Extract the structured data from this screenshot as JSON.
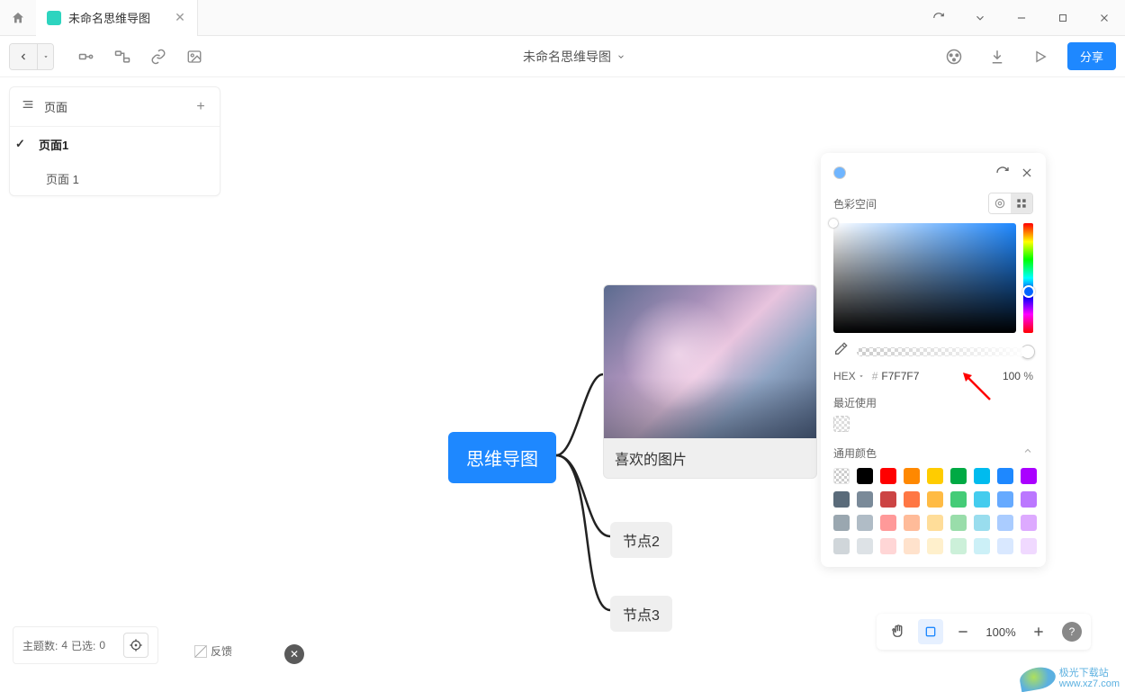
{
  "titlebar": {
    "tab_title": "未命名思维导图"
  },
  "toolbar": {
    "doc_title": "未命名思维导图",
    "share_label": "分享"
  },
  "pages": {
    "header": "页面",
    "items": [
      {
        "label": "页面1",
        "active": true
      },
      {
        "label": "页面 1",
        "active": false
      }
    ]
  },
  "mindmap": {
    "root": "思维导图",
    "image_node_label": "喜欢的图片",
    "node2": "节点2",
    "node3": "节点3"
  },
  "color_picker": {
    "colorspace_label": "色彩空间",
    "hex_label": "HEX",
    "hex_value": "F7F7F7",
    "opacity_value": "100",
    "opacity_unit": "%",
    "recent_label": "最近使用",
    "common_label": "通用颜色",
    "common_colors_row1": [
      "#000000",
      "#ff0000",
      "#ff8800",
      "#ffcc00",
      "#00aa44",
      "#00bbee",
      "#1e88ff",
      "#aa00ff"
    ],
    "common_colors_row2": [
      "#7a8a99",
      "#cc4444",
      "#ff7744",
      "#ffbb44",
      "#44cc77",
      "#44ccee",
      "#66aaff",
      "#bb77ff"
    ],
    "common_colors_row3": [
      "#b0bcc6",
      "#ff9999",
      "#ffbb99",
      "#ffdd99",
      "#99ddaa",
      "#99ddee",
      "#aaccff",
      "#ddaaff"
    ],
    "common_colors_row4": [
      "#dde2e6",
      "#ffd6d6",
      "#ffe2cc",
      "#fff0cc",
      "#ccf0d9",
      "#ccf0f7",
      "#d9e8ff",
      "#f0d9ff"
    ]
  },
  "status": {
    "topics_label": "主题数:",
    "topics_count": "4",
    "selected_label": "已选:",
    "selected_count": "0",
    "feedback_label": "反馈"
  },
  "zoom": {
    "value": "100%"
  },
  "watermark": {
    "line1": "极光下载站",
    "line2": "www.xz7.com"
  }
}
